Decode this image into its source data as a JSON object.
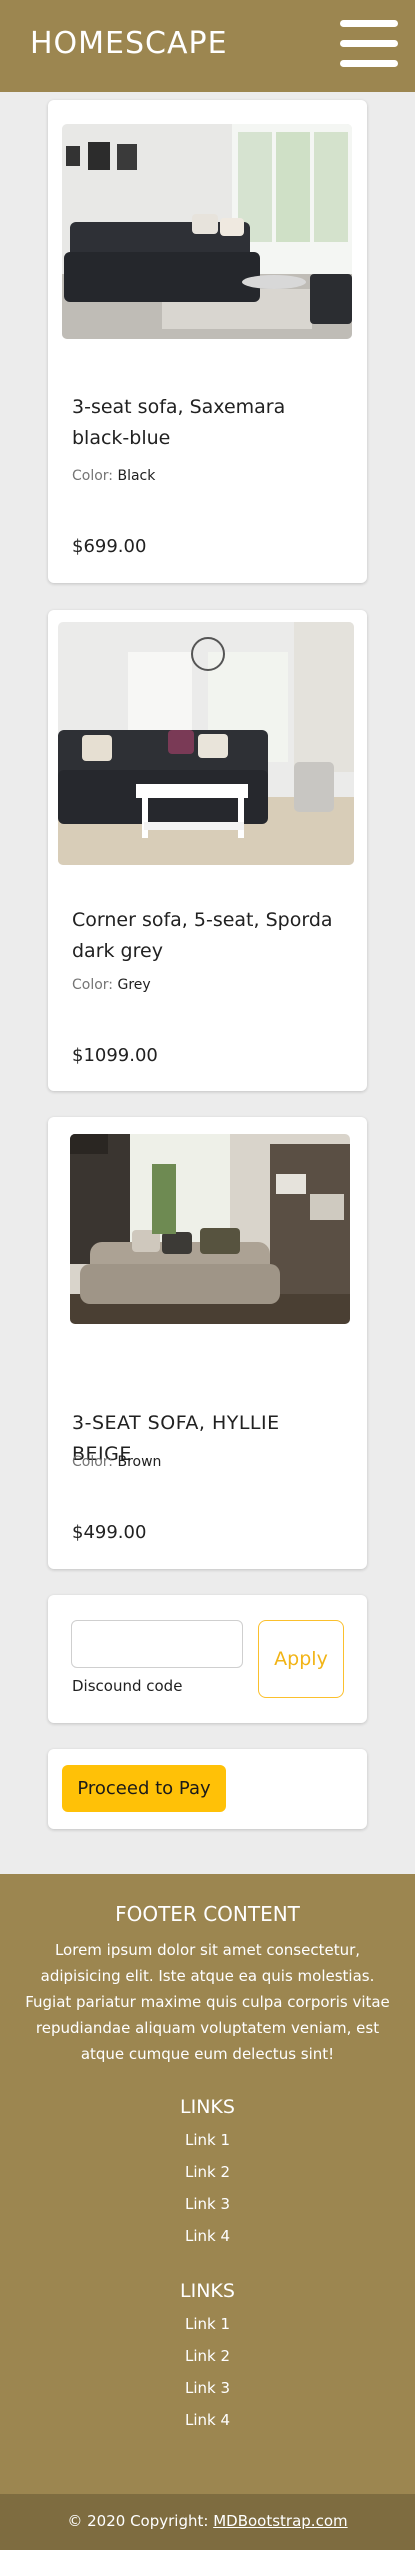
{
  "navbar": {
    "brand": "HOMESCAPE",
    "menu_icon": "hamburger-menu-icon"
  },
  "products": [
    {
      "name": "3-seat sofa, Saxemara black-blue",
      "color_label": "Color: ",
      "color_value": "Black",
      "price": "$699.00",
      "image": "black-sofa-living-room-image"
    },
    {
      "name": "Corner sofa, 5-seat, Sporda dark grey",
      "color_label": "Color: ",
      "color_value": "Grey",
      "price": "$1099.00",
      "image": "grey-corner-sofa-image"
    },
    {
      "name": "3-SEAT SOFA, HYLLIE BEIGE",
      "color_label": "Color: ",
      "color_value": "Brown",
      "price": "$499.00",
      "image": "beige-sofa-image"
    }
  ],
  "discount": {
    "input_value": "",
    "placeholder": "",
    "label": "Discound code",
    "apply_label": "Apply"
  },
  "checkout": {
    "pay_label": "Proceed to Pay"
  },
  "footer": {
    "title": "FOOTER CONTENT",
    "text": "Lorem ipsum dolor sit amet consectetur, adipisicing elit. Iste atque ea quis molestias. Fugiat pariatur maxime quis culpa corporis vitae repudiandae aliquam voluptatem veniam, est atque cumque eum delectus sint!",
    "link_groups": [
      {
        "title": "LINKS",
        "links": [
          "Link 1",
          "Link 2",
          "Link 3",
          "Link 4"
        ]
      },
      {
        "title": "LINKS",
        "links": [
          "Link 1",
          "Link 2",
          "Link 3",
          "Link 4"
        ]
      }
    ],
    "copyright_prefix": "© 2020 Copyright: ",
    "copyright_link": "MDBootstrap.com"
  },
  "colors": {
    "navbar": "#9c8650",
    "footer_bottom": "#7e6c40",
    "accent_yellow": "#ffc107",
    "page_background": "#ececec"
  }
}
